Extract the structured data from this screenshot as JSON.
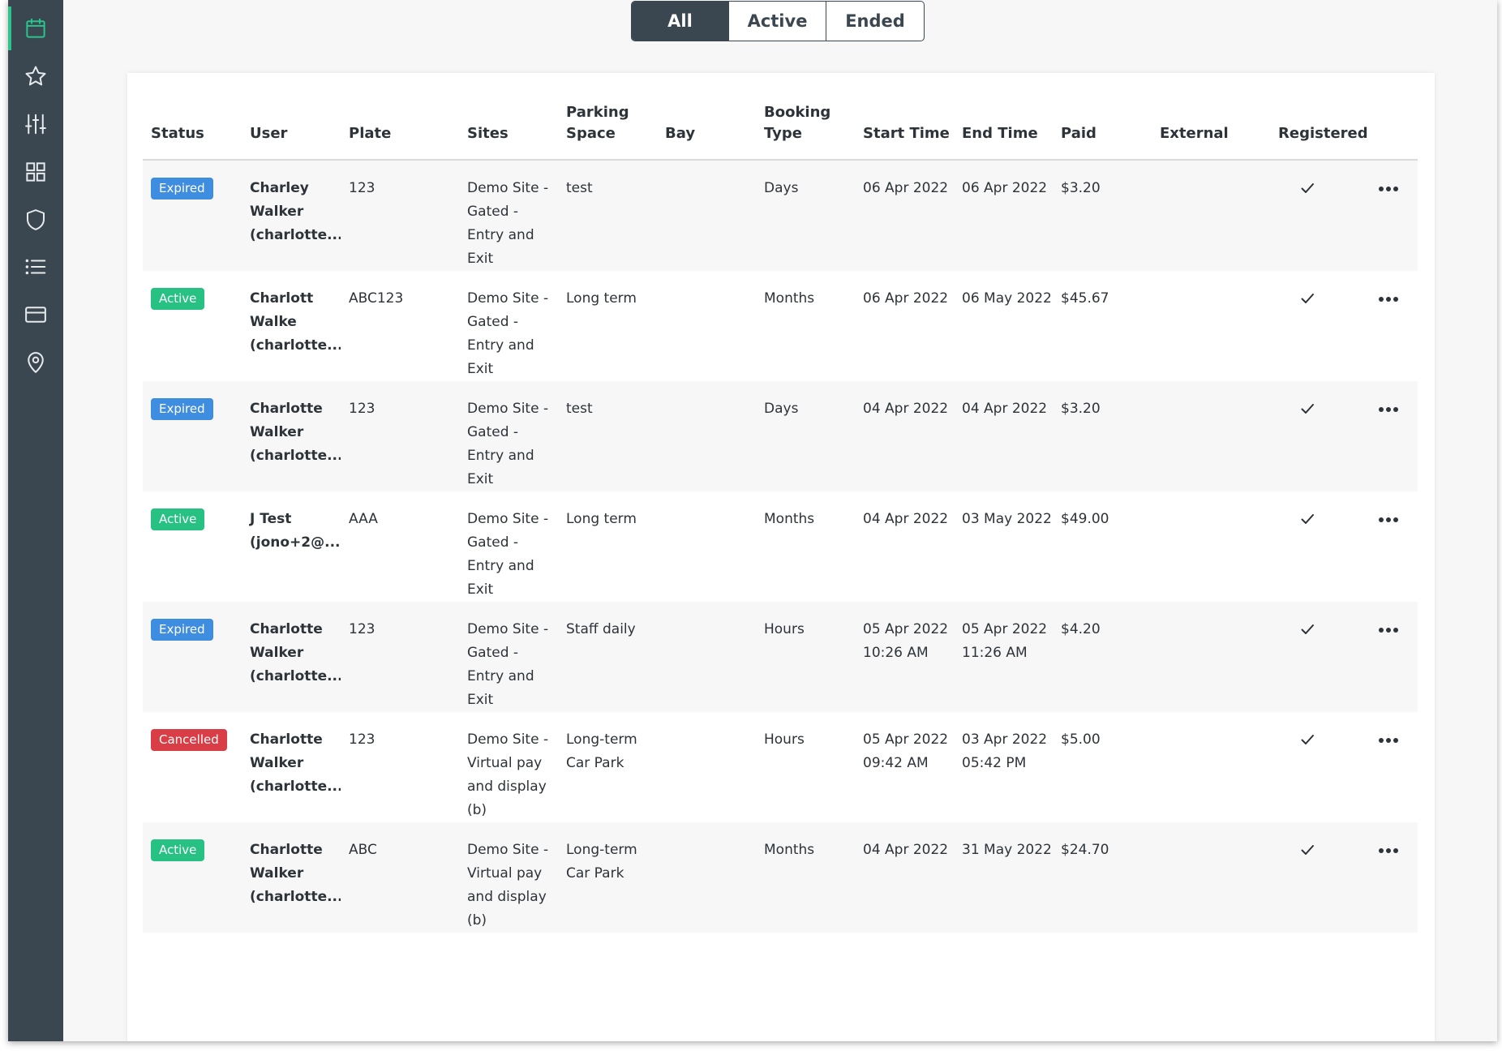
{
  "nav": {
    "items": [
      {
        "icon": "calendar-icon",
        "active": true
      },
      {
        "icon": "star-icon",
        "active": false
      },
      {
        "icon": "sliders-icon",
        "active": false
      },
      {
        "icon": "grid-icon",
        "active": false
      },
      {
        "icon": "shield-icon",
        "active": false
      },
      {
        "icon": "list-icon",
        "active": false
      },
      {
        "icon": "credit-card-icon",
        "active": false
      },
      {
        "icon": "map-pin-icon",
        "active": false
      }
    ],
    "accent": "#2bc48a"
  },
  "filter": {
    "options": [
      "All",
      "Active",
      "Ended"
    ],
    "selected": "All"
  },
  "table": {
    "headers": {
      "status": "Status",
      "user": "User",
      "plate": "Plate",
      "sites": "Sites",
      "parking_space": "Parking Space",
      "bay": "Bay",
      "booking_type": "Booking Type",
      "start_time": "Start Time",
      "end_time": "End Time",
      "paid": "Paid",
      "external": "External",
      "registered": "Registered"
    },
    "rows": [
      {
        "status": "Expired",
        "user": "Charley Walker (charlotte...",
        "plate": "123",
        "sites": "Demo Site - Gated - Entry and Exit",
        "parking_space": "test",
        "bay": "",
        "booking_type": "Days",
        "start_time": "06 Apr 2022",
        "end_time": "06 Apr 2022",
        "paid": "$3.20",
        "external": "",
        "registered": true
      },
      {
        "status": "Active",
        "user": "Charlott Walke (charlotte...",
        "plate": "ABC123",
        "sites": "Demo Site - Gated - Entry and Exit",
        "parking_space": "Long term",
        "bay": "",
        "booking_type": "Months",
        "start_time": "06 Apr 2022",
        "end_time": "06 May 2022",
        "paid": "$45.67",
        "external": "",
        "registered": true
      },
      {
        "status": "Expired",
        "user": "Charlotte Walker (charlotte...",
        "plate": "123",
        "sites": "Demo Site - Gated - Entry and Exit",
        "parking_space": "test",
        "bay": "",
        "booking_type": "Days",
        "start_time": "04 Apr 2022",
        "end_time": "04 Apr 2022",
        "paid": "$3.20",
        "external": "",
        "registered": true
      },
      {
        "status": "Active",
        "user": "J Test (jono+2@...",
        "plate": "AAA",
        "sites": "Demo Site - Gated - Entry and Exit",
        "parking_space": "Long term",
        "bay": "",
        "booking_type": "Months",
        "start_time": "04 Apr 2022",
        "end_time": "03 May 2022",
        "paid": "$49.00",
        "external": "",
        "registered": true
      },
      {
        "status": "Expired",
        "user": "Charlotte Walker (charlotte...",
        "plate": "123",
        "sites": "Demo Site - Gated - Entry and Exit",
        "parking_space": "Staff daily",
        "bay": "",
        "booking_type": "Hours",
        "start_time": "05 Apr 2022 10:26 AM",
        "end_time": "05 Apr 2022 11:26 AM",
        "paid": "$4.20",
        "external": "",
        "registered": true
      },
      {
        "status": "Cancelled",
        "user": "Charlotte Walker (charlotte...",
        "plate": "123",
        "sites": "Demo Site - Virtual pay and display (b)",
        "parking_space": "Long-term Car Park",
        "bay": "",
        "booking_type": "Hours",
        "start_time": "05 Apr 2022 09:42 AM",
        "end_time": "03 Apr 2022 05:42 PM",
        "paid": "$5.00",
        "external": "",
        "registered": true
      },
      {
        "status": "Active",
        "user": "Charlotte Walker (charlotte...",
        "plate": "ABC",
        "sites": "Demo Site - Virtual pay and display (b)",
        "parking_space": "Long-term Car Park",
        "bay": "",
        "booking_type": "Months",
        "start_time": "04 Apr 2022",
        "end_time": "31 May 2022",
        "paid": "$24.70",
        "external": "",
        "registered": true
      }
    ]
  },
  "colors": {
    "sidebar": "#3b4750",
    "expired": "#3f8de0",
    "active": "#27c184",
    "cancelled": "#d93d45"
  }
}
